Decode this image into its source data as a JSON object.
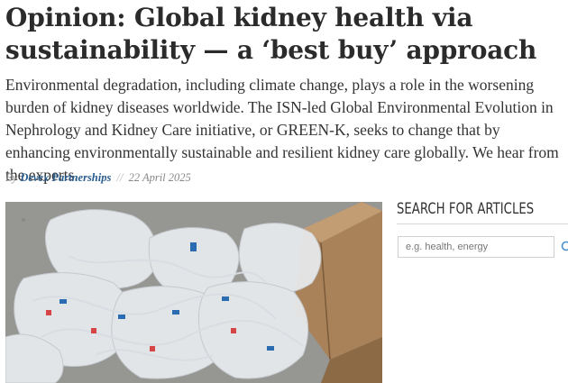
{
  "article": {
    "title": "Opinion: Global kidney health via sustainability — a ‘best buy’ approach",
    "lede": "Environmental degradation, including climate change, plays a role in the worsening burden of kidney diseases worldwide. The ISN-led Global Environmental Evolution in Nephrology and Kidney Care initiative, or GREEN-K, seeks to change that by enhancing environmentally sustainable and resilient kidney care globally. We hear from the experts.",
    "byline": {
      "prefix": "By",
      "author": "Devex Partnerships",
      "separator": "//",
      "date": "22 April 2025"
    }
  },
  "sidebar": {
    "search_heading": "SEARCH FOR ARTICLES",
    "search_placeholder": "e.g. health, energy",
    "search_icon": "search-icon"
  },
  "colors": {
    "author_link": "#2a5d8f",
    "headline": "#2b2b2b"
  }
}
